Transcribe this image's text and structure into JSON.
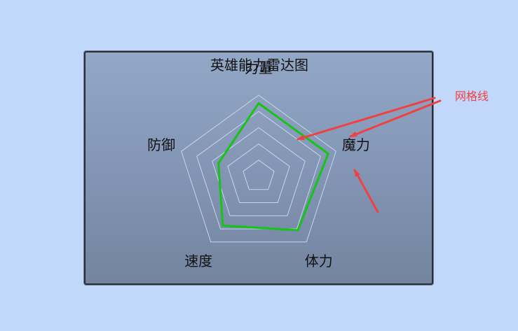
{
  "chart_data": {
    "type": "radar",
    "title": "英雄能力雷达图",
    "indicators": [
      "力量",
      "魔力",
      "体力",
      "速度",
      "防御"
    ],
    "max": 100,
    "grid_levels": 5,
    "series": [
      {
        "values": [
          90,
          90,
          82,
          75,
          52
        ]
      }
    ],
    "colors": {
      "series_line": "#16c416",
      "grid_line": "#c8d6ea",
      "text": "#111111"
    }
  },
  "annotation": {
    "label": "网格线",
    "color": "#f04040"
  }
}
